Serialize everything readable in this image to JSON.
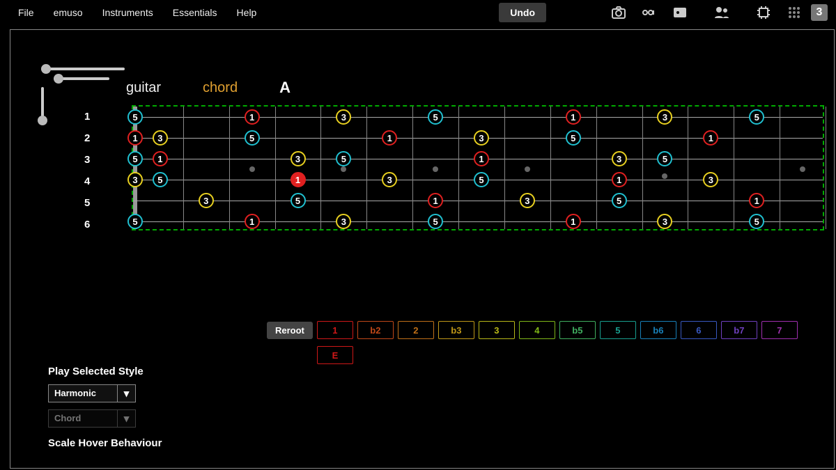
{
  "menu": {
    "items": [
      "File",
      "emuso",
      "Instruments",
      "Essentials",
      "Help"
    ]
  },
  "undo_label": "Undo",
  "badge3": "3",
  "header": {
    "instrument": "guitar",
    "mode": "chord",
    "note": "A"
  },
  "string_numbers": [
    "1",
    "2",
    "3",
    "4",
    "5",
    "6"
  ],
  "frets": 15,
  "frets_dots_single": [
    3,
    5,
    7,
    9,
    15
  ],
  "frets_dots_double": [
    12
  ],
  "notes": [
    {
      "s": 1,
      "f": 0,
      "i": "5",
      "c": "cyan"
    },
    {
      "s": 2,
      "f": 0,
      "i": "1",
      "c": "red"
    },
    {
      "s": 3,
      "f": 0,
      "i": "5",
      "c": "cyan"
    },
    {
      "s": 4,
      "f": 0,
      "i": "3",
      "c": "yellow"
    },
    {
      "s": 5,
      "f": 0,
      "i": "",
      "c": "none"
    },
    {
      "s": 6,
      "f": 0,
      "i": "5",
      "c": "cyan"
    },
    {
      "s": 2,
      "f": 1,
      "i": "3",
      "c": "yellow"
    },
    {
      "s": 3,
      "f": 1,
      "i": "1",
      "c": "red"
    },
    {
      "s": 4,
      "f": 1,
      "i": "5",
      "c": "cyan"
    },
    {
      "s": 5,
      "f": 2,
      "i": "3",
      "c": "yellow"
    },
    {
      "s": 1,
      "f": 3,
      "i": "1",
      "c": "red"
    },
    {
      "s": 2,
      "f": 3,
      "i": "5",
      "c": "cyan"
    },
    {
      "s": 6,
      "f": 3,
      "i": "1",
      "c": "red"
    },
    {
      "s": 3,
      "f": 4,
      "i": "3",
      "c": "yellow"
    },
    {
      "s": 4,
      "f": 4,
      "i": "1",
      "c": "red",
      "filled": true
    },
    {
      "s": 5,
      "f": 4,
      "i": "5",
      "c": "cyan"
    },
    {
      "s": 1,
      "f": 5,
      "i": "3",
      "c": "yellow"
    },
    {
      "s": 3,
      "f": 5,
      "i": "5",
      "c": "cyan"
    },
    {
      "s": 6,
      "f": 5,
      "i": "3",
      "c": "yellow"
    },
    {
      "s": 2,
      "f": 6,
      "i": "1",
      "c": "red"
    },
    {
      "s": 4,
      "f": 6,
      "i": "3",
      "c": "yellow"
    },
    {
      "s": 1,
      "f": 7,
      "i": "5",
      "c": "cyan"
    },
    {
      "s": 5,
      "f": 7,
      "i": "1",
      "c": "red"
    },
    {
      "s": 6,
      "f": 7,
      "i": "5",
      "c": "cyan"
    },
    {
      "s": 2,
      "f": 8,
      "i": "3",
      "c": "yellow"
    },
    {
      "s": 3,
      "f": 8,
      "i": "1",
      "c": "red"
    },
    {
      "s": 4,
      "f": 8,
      "i": "5",
      "c": "cyan"
    },
    {
      "s": 5,
      "f": 9,
      "i": "3",
      "c": "yellow"
    },
    {
      "s": 1,
      "f": 10,
      "i": "1",
      "c": "red"
    },
    {
      "s": 2,
      "f": 10,
      "i": "5",
      "c": "cyan"
    },
    {
      "s": 6,
      "f": 10,
      "i": "1",
      "c": "red"
    },
    {
      "s": 3,
      "f": 11,
      "i": "3",
      "c": "yellow"
    },
    {
      "s": 4,
      "f": 11,
      "i": "1",
      "c": "red"
    },
    {
      "s": 5,
      "f": 11,
      "i": "5",
      "c": "cyan"
    },
    {
      "s": 1,
      "f": 12,
      "i": "3",
      "c": "yellow"
    },
    {
      "s": 3,
      "f": 12,
      "i": "5",
      "c": "cyan"
    },
    {
      "s": 6,
      "f": 12,
      "i": "3",
      "c": "yellow"
    },
    {
      "s": 2,
      "f": 13,
      "i": "1",
      "c": "red"
    },
    {
      "s": 4,
      "f": 13,
      "i": "3",
      "c": "yellow"
    },
    {
      "s": 1,
      "f": 14,
      "i": "5",
      "c": "cyan"
    },
    {
      "s": 5,
      "f": 14,
      "i": "1",
      "c": "red"
    },
    {
      "s": 6,
      "f": 14,
      "i": "5",
      "c": "cyan"
    }
  ],
  "reroot_label": "Reroot",
  "intervals": [
    "1",
    "b2",
    "2",
    "b3",
    "3",
    "4",
    "b5",
    "5",
    "b6",
    "6",
    "b7",
    "7"
  ],
  "note_btn": "E",
  "play_style_label": "Play Selected Style",
  "dropdown1": "Harmonic",
  "dropdown2": "Chord",
  "scale_hover_label": "Scale Hover Behaviour"
}
